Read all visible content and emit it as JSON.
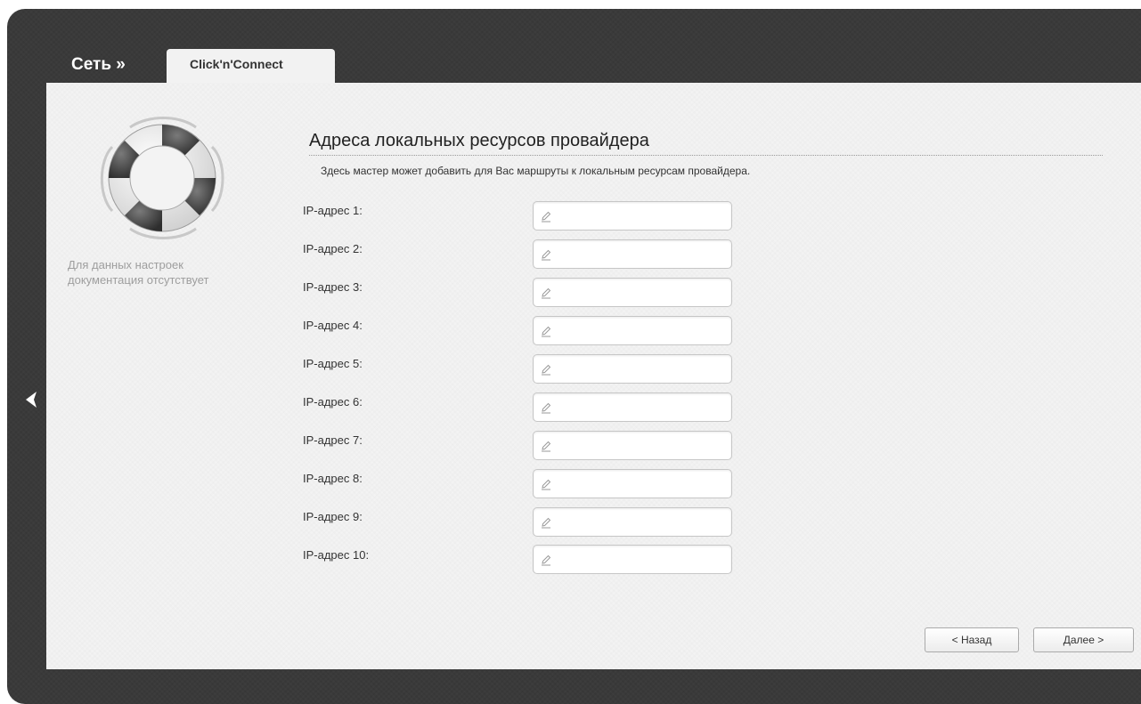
{
  "header": {
    "breadcrumb": "Сеть »",
    "tab_label": "Click'n'Connect"
  },
  "sidebar": {
    "help_icon": "lifebuoy-icon",
    "help_text": "Для данных настроек документация отсутствует"
  },
  "nav": {
    "back_icon": "chevron-left-icon"
  },
  "main": {
    "title": "Адреса локальных ресурсов провайдера",
    "description": "Здесь мастер может добавить для Вас маршруты к локальным ресурсам провайдера.",
    "fields": [
      {
        "label": "IP-адрес 1:",
        "value": "",
        "icon": "pencil-icon"
      },
      {
        "label": "IP-адрес 2:",
        "value": "",
        "icon": "pencil-icon"
      },
      {
        "label": "IP-адрес 3:",
        "value": "",
        "icon": "pencil-icon"
      },
      {
        "label": "IP-адрес 4:",
        "value": "",
        "icon": "pencil-icon"
      },
      {
        "label": "IP-адрес 5:",
        "value": "",
        "icon": "pencil-icon"
      },
      {
        "label": "IP-адрес 6:",
        "value": "",
        "icon": "pencil-icon"
      },
      {
        "label": "IP-адрес 7:",
        "value": "",
        "icon": "pencil-icon"
      },
      {
        "label": "IP-адрес 8:",
        "value": "",
        "icon": "pencil-icon"
      },
      {
        "label": "IP-адрес 9:",
        "value": "",
        "icon": "pencil-icon"
      },
      {
        "label": "IP-адрес 10:",
        "value": "",
        "icon": "pencil-icon"
      }
    ]
  },
  "footer": {
    "back_label": "< Назад",
    "next_label": "Далее >"
  },
  "colors": {
    "frame": "#3a3a3a",
    "panel": "#f3f3f3",
    "help_text": "#9e9e9e"
  }
}
